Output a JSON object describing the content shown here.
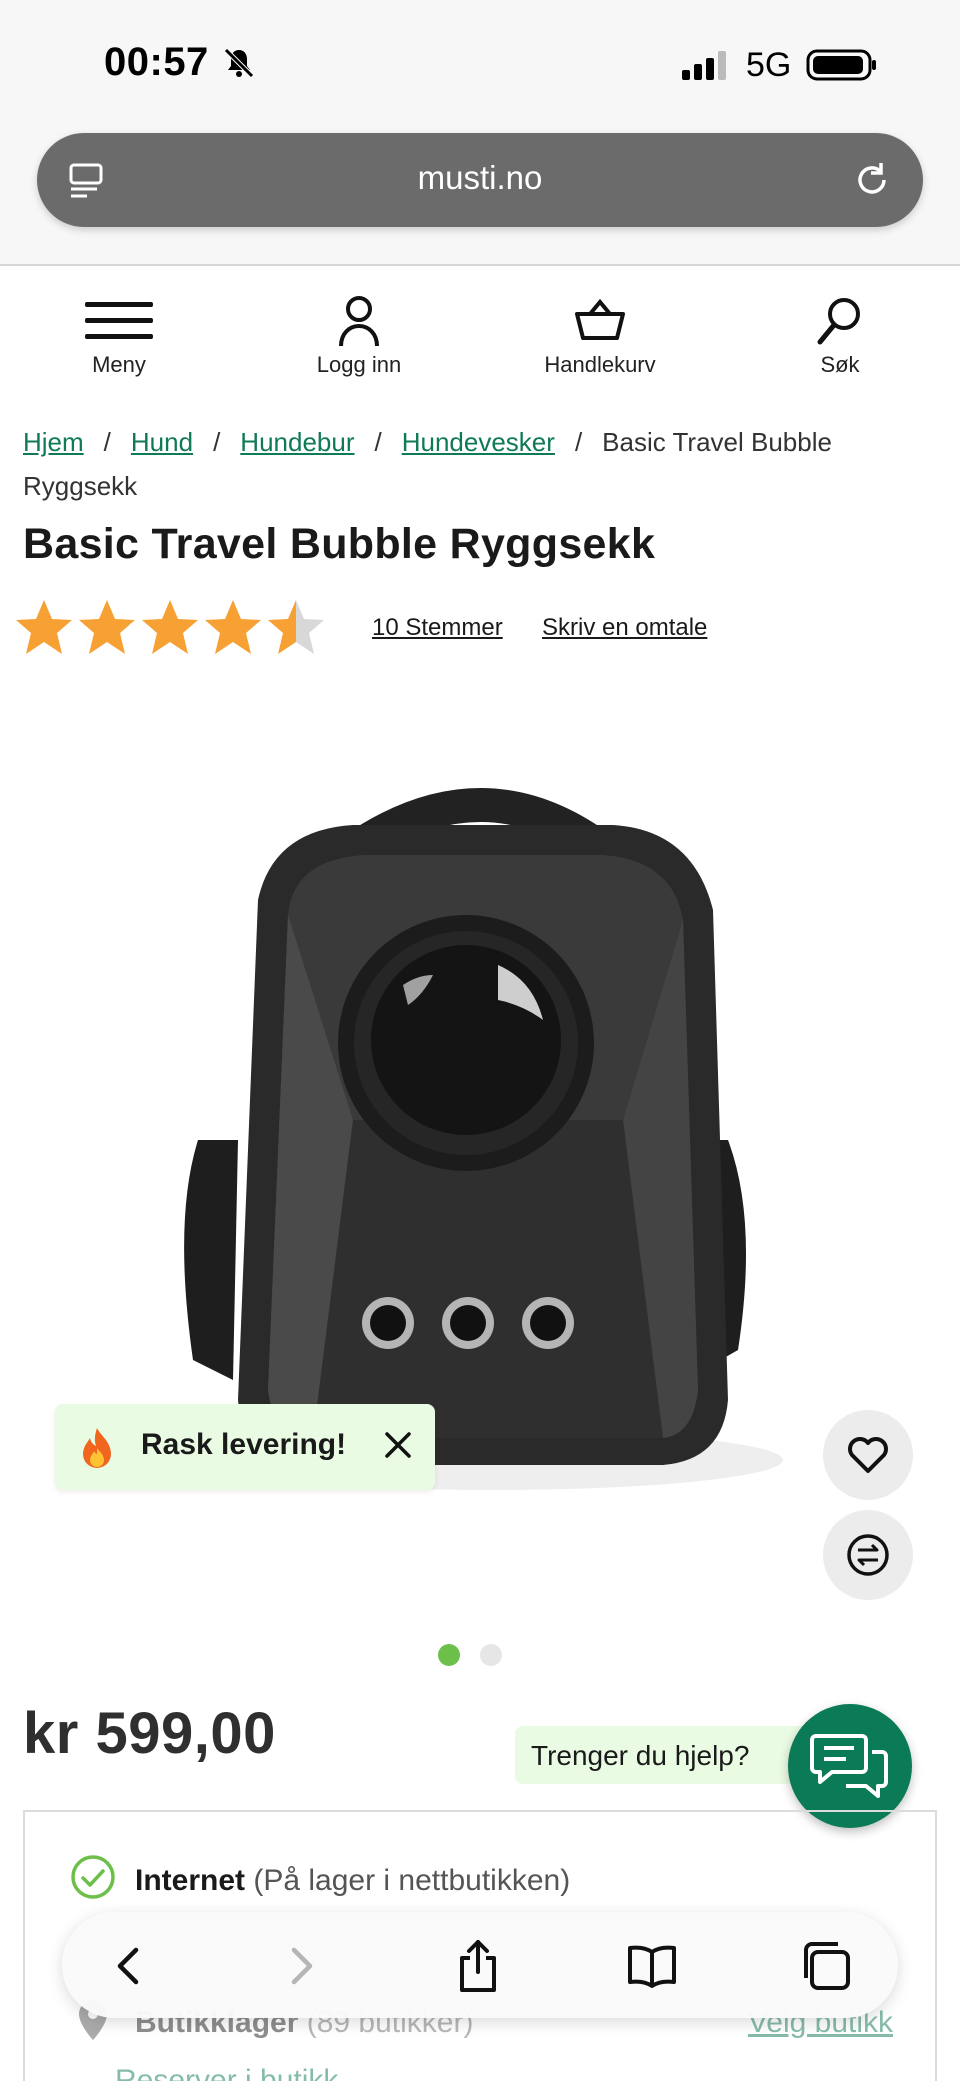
{
  "status_bar": {
    "time": "00:57",
    "network": "5G",
    "icons": [
      "bell-muted-icon",
      "signal-icon",
      "battery-icon"
    ]
  },
  "browser": {
    "url": "musti.no",
    "icons": [
      "tabs-icon",
      "reload-icon"
    ]
  },
  "site_nav": {
    "items": [
      {
        "label": "Meny",
        "icon": "menu-icon"
      },
      {
        "label": "Logg inn",
        "icon": "user-icon"
      },
      {
        "label": "Handlekurv",
        "icon": "basket-icon"
      },
      {
        "label": "Søk",
        "icon": "search-icon"
      }
    ]
  },
  "breadcrumb": {
    "links": [
      "Hjem",
      "Hund",
      "Hundebur",
      "Hundevesker"
    ],
    "separator": "/",
    "current": "Basic Travel Bubble Ryggsekk"
  },
  "product": {
    "title": "Basic Travel Bubble Ryggsekk",
    "rating": 4.5,
    "rating_max": 5,
    "votes_label": "10 Stemmer",
    "review_label": "Skriv en omtale",
    "price": "kr 599,00",
    "image_count": 2,
    "active_image": 1
  },
  "toast": {
    "text": "Rask levering!",
    "icon": "fire-icon"
  },
  "help": {
    "label": "Trenger du hjelp?"
  },
  "stock": {
    "internet_label": "Internet",
    "internet_status": "(På lager i nettbutikken)",
    "store_label": "Butikklager",
    "store_count": "(89 butikker)",
    "choose_store": "Velg butikk",
    "reserve": "Reserver i butikk"
  },
  "colors": {
    "brand_green": "#0b7a57",
    "link_green": "#0f7a57",
    "star_orange": "#f7a033",
    "toast_bg": "#eafbe4",
    "dot_active": "#6cc04a"
  },
  "toolbar": {
    "icons": [
      "back-icon",
      "forward-icon",
      "share-icon",
      "bookmarks-icon",
      "tabs-overview-icon"
    ]
  }
}
